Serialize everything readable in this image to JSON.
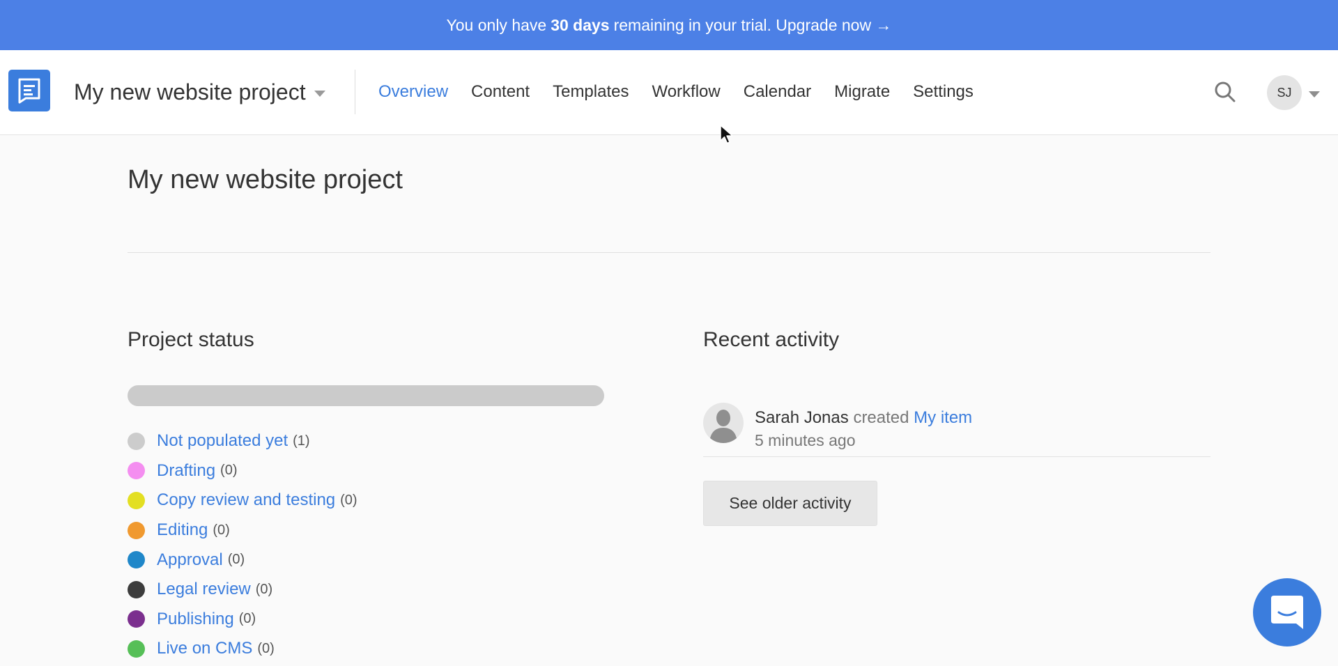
{
  "banner": {
    "prefix": "You only have",
    "days": "30 days",
    "suffix": "remaining in your trial. Upgrade now →"
  },
  "header": {
    "project_name": "My new website project",
    "tabs": [
      {
        "label": "Overview",
        "active": true
      },
      {
        "label": "Content"
      },
      {
        "label": "Templates"
      },
      {
        "label": "Workflow"
      },
      {
        "label": "Calendar"
      },
      {
        "label": "Migrate"
      },
      {
        "label": "Settings"
      }
    ],
    "user_initials": "SJ",
    "icons": {
      "logo": "document-logo-icon",
      "search": "search-icon",
      "menu": "chevron-down-icon"
    }
  },
  "page": {
    "title": "My new website project"
  },
  "project_status": {
    "heading": "Project status",
    "progress_fraction": 0,
    "statuses": [
      {
        "label": "Not populated yet",
        "count": "(1)",
        "color": "#cccccc"
      },
      {
        "label": "Drafting",
        "count": "(0)",
        "color": "#f48ef0"
      },
      {
        "label": "Copy review and testing",
        "count": "(0)",
        "color": "#e3df22"
      },
      {
        "label": "Editing",
        "count": "(0)",
        "color": "#f0992f"
      },
      {
        "label": "Approval",
        "count": "(0)",
        "color": "#1f87c9"
      },
      {
        "label": "Legal review",
        "count": "(0)",
        "color": "#3c3c3c"
      },
      {
        "label": "Publishing",
        "count": "(0)",
        "color": "#7b2f8e"
      },
      {
        "label": "Live on CMS",
        "count": "(0)",
        "color": "#56bf57"
      }
    ]
  },
  "recent_activity": {
    "heading": "Recent activity",
    "items": [
      {
        "user": "Sarah Jonas",
        "verb": "created",
        "target": "My item",
        "time": "5 minutes ago"
      }
    ],
    "older_label": "See older activity"
  },
  "colors": {
    "accent": "#3b7ddd",
    "banner": "#4c80e6"
  }
}
